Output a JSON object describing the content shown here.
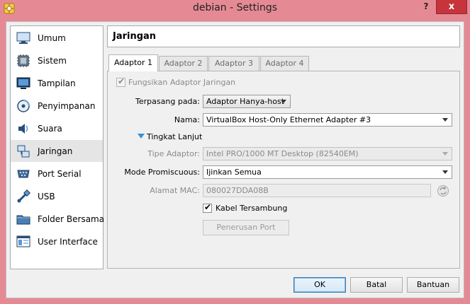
{
  "window": {
    "title": "debian - Settings",
    "help_glyph": "?",
    "close_glyph": "x"
  },
  "sidebar": {
    "items": [
      {
        "label": "Umum",
        "icon": "monitor-icon"
      },
      {
        "label": "Sistem",
        "icon": "chip-icon"
      },
      {
        "label": "Tampilan",
        "icon": "display-icon"
      },
      {
        "label": "Penyimpanan",
        "icon": "storage-icon"
      },
      {
        "label": "Suara",
        "icon": "speaker-icon"
      },
      {
        "label": "Jaringan",
        "icon": "network-icon",
        "selected": true
      },
      {
        "label": "Port Serial",
        "icon": "serial-port-icon"
      },
      {
        "label": "USB",
        "icon": "usb-icon"
      },
      {
        "label": "Folder Bersama",
        "icon": "shared-folder-icon"
      },
      {
        "label": "User Interface",
        "icon": "user-interface-icon"
      }
    ]
  },
  "page": {
    "title": "Jaringan"
  },
  "tabs": [
    {
      "label": "Adaptor 1",
      "active": true
    },
    {
      "label": "Adaptor 2"
    },
    {
      "label": "Adaptor 3"
    },
    {
      "label": "Adaptor 4"
    }
  ],
  "form": {
    "enable_adapter": {
      "label": "Fungsikan Adaptor Jaringan",
      "checked": true,
      "enabled": false
    },
    "attached_to": {
      "label": "Terpasang pada:",
      "value": "Adaptor Hanya-host"
    },
    "name": {
      "label": "Nama:",
      "value": "VirtualBox Host-Only Ethernet Adapter #3"
    },
    "advanced": {
      "label": "Tingkat Lanjut"
    },
    "adapter_type": {
      "label": "Tipe Adaptor:",
      "value": "Intel PRO/1000 MT Desktop (82540EM)"
    },
    "promiscuous": {
      "label": "Mode Promiscuous:",
      "value": "Ijinkan Semua"
    },
    "mac": {
      "label": "Alamat MAC:",
      "value": "080027DDA08B"
    },
    "cable": {
      "label": "Kabel Tersambung",
      "checked": true
    },
    "port_forwarding": {
      "label": "Penerusan Port"
    }
  },
  "buttons": {
    "ok": "OK",
    "cancel": "Batal",
    "help": "Bantuan"
  },
  "colors": {
    "accent": "#3b8fd6",
    "titlebar": "#e58a95",
    "close": "#c7343c"
  }
}
